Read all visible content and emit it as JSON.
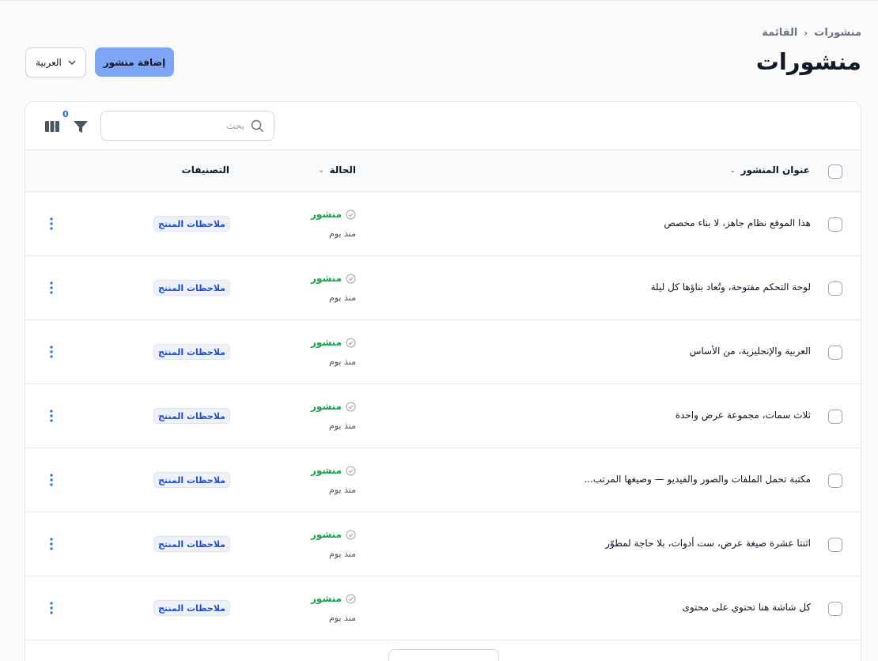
{
  "breadcrumb": {
    "root": "منشورات",
    "current": "القائمة"
  },
  "page": {
    "title": "منشورات"
  },
  "actions": {
    "add_label": "إضافة منشور",
    "language": "العربية"
  },
  "toolbar": {
    "search_placeholder": "بحث",
    "filter_count": "0"
  },
  "table": {
    "headers": {
      "title": "عنوان المنشور",
      "status": "الحالة",
      "categories": "التصنيفات"
    },
    "rows": [
      {
        "title": "هذا الموقع نظام جاهز، لا بناء مخصص",
        "status": "منشور",
        "time": "منذ يوم",
        "category": "ملاحظات المنتج"
      },
      {
        "title": "لوحة التحكم مفتوحة، وتُعاد بناؤها كل ليلة",
        "status": "منشور",
        "time": "منذ يوم",
        "category": "ملاحظات المنتج"
      },
      {
        "title": "العربية والإنجليزية، من الأساس",
        "status": "منشور",
        "time": "منذ يوم",
        "category": "ملاحظات المنتج"
      },
      {
        "title": "ثلاث سمات، مجموعة عرض واحدة",
        "status": "منشور",
        "time": "منذ يوم",
        "category": "ملاحظات المنتج"
      },
      {
        "title": "مكتبة تحمل الملفات والصور والفيديو — وصيغها المرتب...",
        "status": "منشور",
        "time": "منذ يوم",
        "category": "ملاحظات المنتج"
      },
      {
        "title": "اثنتا عشرة صيغة عرض، ست أدوات، بلا حاجة لمطوّر",
        "status": "منشور",
        "time": "منذ يوم",
        "category": "ملاحظات المنتج"
      },
      {
        "title": "كل شاشة هنا تحتوي على محتوى",
        "status": "منشور",
        "time": "منذ يوم",
        "category": "ملاحظات المنتج"
      }
    ]
  },
  "colors": {
    "primary": "#7fa6f5",
    "success": "#16a34a",
    "tag_text": "#1d4ed8"
  },
  "icons": {
    "search": "search-icon",
    "filter": "funnel-icon",
    "columns": "columns-icon",
    "more": "more-vertical-icon"
  }
}
